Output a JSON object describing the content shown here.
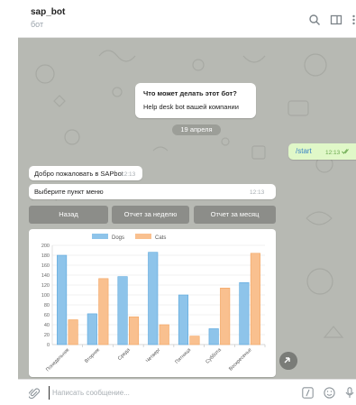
{
  "header": {
    "title": "sap_bot",
    "subtitle": "бот",
    "icons": [
      "search-icon",
      "side-panel-icon",
      "more-icon"
    ]
  },
  "info_card": {
    "title": "Что может делать этот бот?",
    "text": "Help desk bot вашей компании"
  },
  "date_pill": "19 апреля",
  "messages": {
    "outgoing": {
      "text": "/start",
      "time": "12:13"
    },
    "incoming1": {
      "text": "Добро пожаловать в SAPbot",
      "time": "12:13"
    },
    "incoming2": {
      "text": "Выберите пункт меню",
      "time": "12:13"
    }
  },
  "keyboard": {
    "back": "Назад",
    "week_report": "Отчет за неделю",
    "month_report": "Отчет за месяц"
  },
  "composer": {
    "placeholder": "Написать сообщение..."
  },
  "colors": {
    "chat_bg": "#b7b9b3",
    "outgoing_bubble": "#e0f8c8",
    "button_bg": "#8c8d89",
    "dogs": "#8ec4ea",
    "cats": "#f9c08f"
  },
  "chart_data": {
    "type": "bar",
    "categories": [
      "Понедельник",
      "Вторник",
      "Среда",
      "Четверг",
      "Пятница",
      "Суббота",
      "Воскресенье"
    ],
    "series": [
      {
        "name": "Dogs",
        "values": [
          180,
          62,
          137,
          186,
          100,
          32,
          125
        ]
      },
      {
        "name": "Cats",
        "values": [
          50,
          133,
          56,
          40,
          17,
          114,
          184
        ]
      }
    ],
    "ylim": [
      0,
      200
    ],
    "yticks": [
      0,
      20,
      40,
      60,
      80,
      100,
      120,
      140,
      160,
      180,
      200
    ],
    "grid": true,
    "legend": "top"
  }
}
